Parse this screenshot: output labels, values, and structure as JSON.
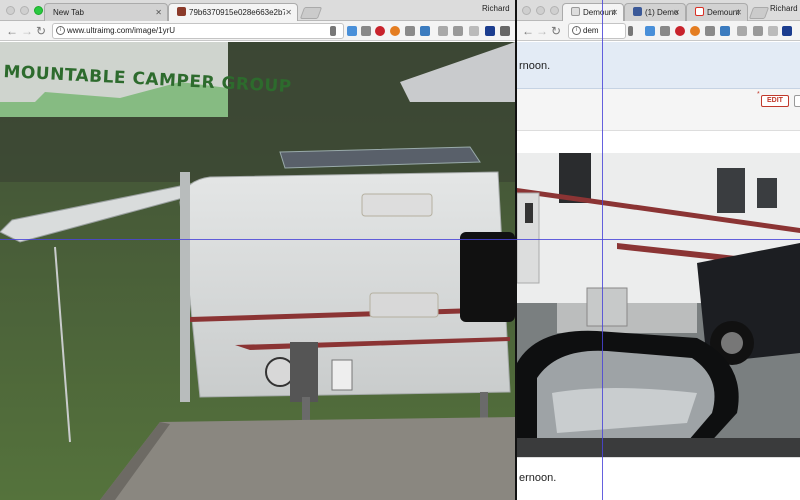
{
  "left_browser": {
    "tabs": [
      {
        "label": "New Tab",
        "active": false
      },
      {
        "label": "79b6370915e028e663e2b7",
        "active": true
      }
    ],
    "profile": "Richard",
    "url": "www.ultraimg.com/image/1yrU",
    "image": {
      "sign_text": "MOUNTABLE CAMPER GROUP"
    }
  },
  "right_browser": {
    "tabs": [
      {
        "label": "Demount",
        "active": true
      },
      {
        "label": "(1) Demo",
        "active": false
      },
      {
        "label": "Demount",
        "active": false
      }
    ],
    "profile": "Richard",
    "url": "dem",
    "page": {
      "top_text": "rnoon.",
      "edit_label": "EDIT",
      "bottom_text": "ernoon."
    }
  },
  "colors": {
    "link_blue": "#1a0dab",
    "edit_red": "#c0392b",
    "facebook": "#3b5998",
    "gmail_red": "#d93025"
  }
}
